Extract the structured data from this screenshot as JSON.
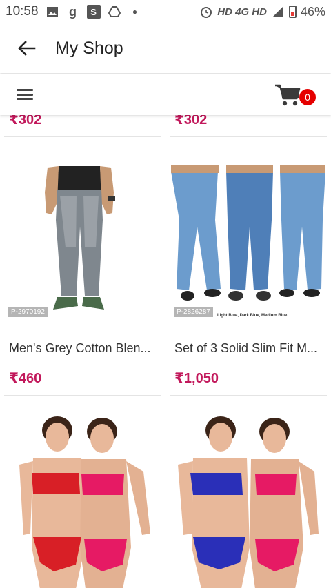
{
  "status_bar": {
    "time": "10:58",
    "right_text": "HD 4G HD",
    "battery": "46%"
  },
  "header": {
    "title": "My Shop"
  },
  "toolbar": {
    "cart_count": "0"
  },
  "products": {
    "partial_top": [
      {
        "price": "₹302"
      },
      {
        "price": "₹302"
      }
    ],
    "row1": [
      {
        "id": "P-2970192",
        "name": "Men's Grey Cotton Blen...",
        "price": "₹460"
      },
      {
        "id": "P-2826287",
        "caption": "Light Blue, Dark Blue, Medium Blue",
        "name": "Set of 3 Solid Slim Fit M...",
        "price": "₹1,050"
      }
    ]
  },
  "colors": {
    "price": "#c2185b",
    "badge": "#e50000"
  }
}
